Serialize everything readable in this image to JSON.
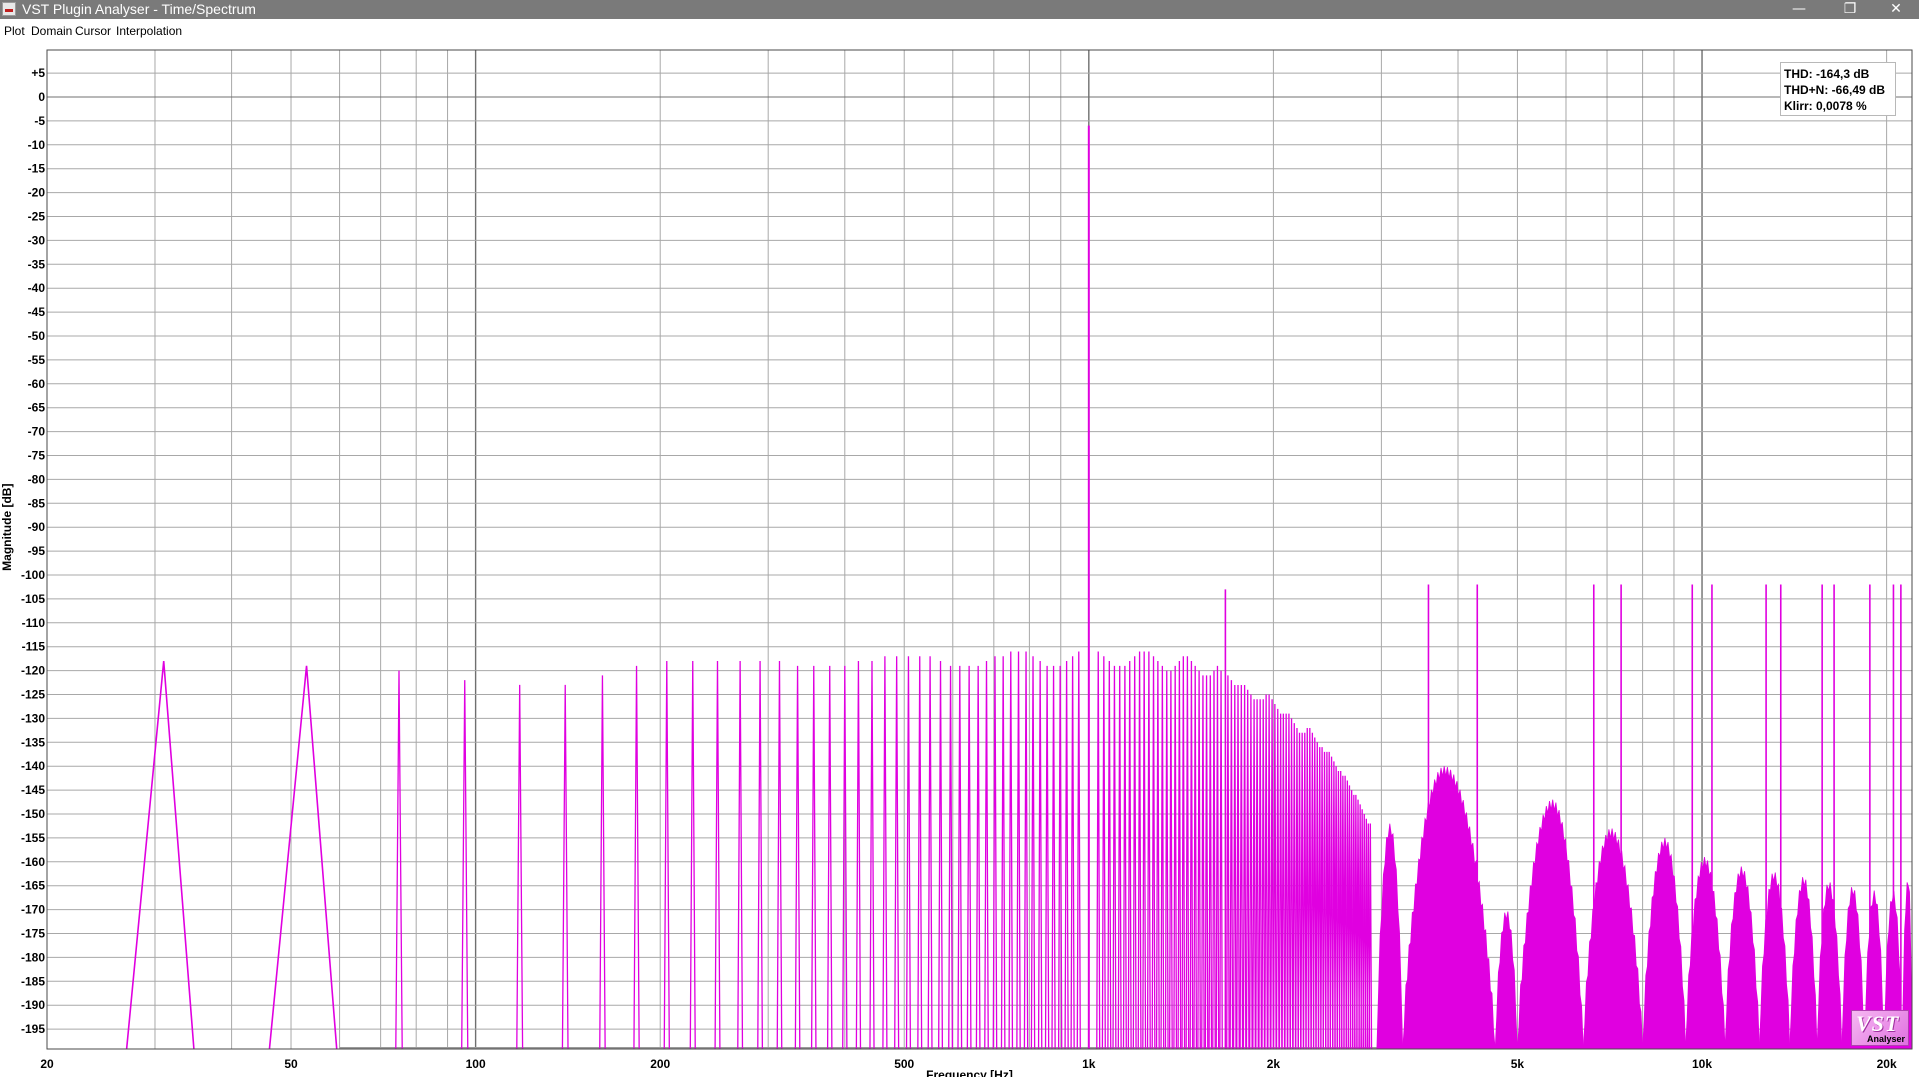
{
  "window": {
    "title": "VST Plugin Analyser - Time/Spectrum",
    "icon": "app-icon",
    "controls": [
      "minimize-icon",
      "restore-icon",
      "close-icon"
    ]
  },
  "menu": {
    "items": [
      "Plot",
      "Domain",
      "Cursor",
      "Interpolation"
    ]
  },
  "stats": {
    "thd": "THD: -164,3 dB",
    "thdn": "THD+N: -66,49 dB",
    "klirr": "Klirr: 0,0078 %"
  },
  "logo": {
    "sub": "Analyser"
  },
  "colors": {
    "spectrum": "#e000e0",
    "grid": "#a8a8a8",
    "titlebar": "#7a7a7a"
  },
  "chart_data": {
    "type": "line",
    "xscale": "log",
    "xlim": [
      20,
      22000
    ],
    "ylim": [
      -200,
      10
    ],
    "grid": true,
    "xlabel": "Frequency [Hz]",
    "ylabel": "Magnitude [dB]",
    "x_ticks": [
      {
        "v": 20,
        "label": "20"
      },
      {
        "v": 50,
        "label": "50"
      },
      {
        "v": 100,
        "label": "100"
      },
      {
        "v": 200,
        "label": "200"
      },
      {
        "v": 500,
        "label": "500"
      },
      {
        "v": 1000,
        "label": "1k"
      },
      {
        "v": 2000,
        "label": "2k"
      },
      {
        "v": 5000,
        "label": "5k"
      },
      {
        "v": 10000,
        "label": "10k"
      },
      {
        "v": 20000,
        "label": "20k"
      }
    ],
    "y_ticks": [
      "+5",
      "0",
      "-5",
      "-10",
      "-15",
      "-20",
      "-25",
      "-30",
      "-35",
      "-40",
      "-45",
      "-50",
      "-55",
      "-60",
      "-65",
      "-70",
      "-75",
      "-80",
      "-85",
      "-90",
      "-95",
      "-100",
      "-105",
      "-110",
      "-115",
      "-120",
      "-125",
      "-130",
      "-135",
      "-140",
      "-145",
      "-150",
      "-155",
      "-160",
      "-165",
      "-170",
      "-175",
      "-180",
      "-185",
      "-190",
      "-195"
    ],
    "fundamental": {
      "freq": 1000,
      "level": -6
    },
    "spur_lines": [
      {
        "freq": 1670,
        "level": -103
      },
      {
        "freq": 3580,
        "level": -102
      },
      {
        "freq": 4300,
        "level": -102
      },
      {
        "freq": 6660,
        "level": -102
      },
      {
        "freq": 7380,
        "level": -102
      },
      {
        "freq": 9640,
        "level": -102
      },
      {
        "freq": 10380,
        "level": -102
      },
      {
        "freq": 12720,
        "level": -102
      },
      {
        "freq": 13440,
        "level": -102
      },
      {
        "freq": 15700,
        "level": -102
      },
      {
        "freq": 16420,
        "level": -102
      },
      {
        "freq": 18780,
        "level": -102
      },
      {
        "freq": 20520,
        "level": -102
      },
      {
        "freq": 21100,
        "level": -102
      }
    ],
    "comb_spikes": [
      {
        "freq": 31,
        "level": -118
      },
      {
        "freq": 53,
        "level": -119
      },
      {
        "freq": 75,
        "level": -120
      },
      {
        "freq": 96,
        "level": -122
      },
      {
        "freq": 118,
        "level": -123
      },
      {
        "freq": 140,
        "level": -123
      },
      {
        "freq": 161,
        "level": -121
      },
      {
        "freq": 183,
        "level": -119
      },
      {
        "freq": 205,
        "level": -118
      },
      {
        "freq": 226,
        "level": -118
      },
      {
        "freq": 248,
        "level": -118
      },
      {
        "freq": 270,
        "level": -118
      },
      {
        "freq": 291,
        "level": -118
      },
      {
        "freq": 313,
        "level": -118
      },
      {
        "freq": 335,
        "level": -119
      },
      {
        "freq": 356,
        "level": -119
      },
      {
        "freq": 378,
        "level": -119
      },
      {
        "freq": 400,
        "level": -119
      },
      {
        "freq": 421,
        "level": -118
      },
      {
        "freq": 443,
        "level": -118
      },
      {
        "freq": 465,
        "level": -117
      },
      {
        "freq": 486,
        "level": -117
      },
      {
        "freq": 508,
        "level": -117
      },
      {
        "freq": 530,
        "level": -117
      },
      {
        "freq": 551,
        "level": -117
      },
      {
        "freq": 573,
        "level": -118
      },
      {
        "freq": 595,
        "level": -119
      },
      {
        "freq": 616,
        "level": -119
      },
      {
        "freq": 638,
        "level": -119
      },
      {
        "freq": 660,
        "level": -119
      },
      {
        "freq": 681,
        "level": -118
      },
      {
        "freq": 703,
        "level": -117
      },
      {
        "freq": 725,
        "level": -117
      },
      {
        "freq": 746,
        "level": -116
      },
      {
        "freq": 768,
        "level": -116
      },
      {
        "freq": 790,
        "level": -116
      },
      {
        "freq": 811,
        "level": -117
      },
      {
        "freq": 833,
        "level": -118
      },
      {
        "freq": 855,
        "level": -119
      },
      {
        "freq": 876,
        "level": -119
      },
      {
        "freq": 898,
        "level": -119
      },
      {
        "freq": 920,
        "level": -118
      },
      {
        "freq": 941,
        "level": -117
      },
      {
        "freq": 963,
        "level": -116
      },
      {
        "freq": 1036,
        "level": -116
      },
      {
        "freq": 1058,
        "level": -117
      },
      {
        "freq": 1080,
        "level": -118
      },
      {
        "freq": 1101,
        "level": -119
      },
      {
        "freq": 1123,
        "level": -119
      },
      {
        "freq": 1145,
        "level": -119
      },
      {
        "freq": 1166,
        "level": -118
      },
      {
        "freq": 1188,
        "level": -117
      },
      {
        "freq": 1210,
        "level": -116
      },
      {
        "freq": 1231,
        "level": -116
      },
      {
        "freq": 1253,
        "level": -116
      },
      {
        "freq": 1275,
        "level": -117
      },
      {
        "freq": 1296,
        "level": -118
      },
      {
        "freq": 1318,
        "level": -119
      },
      {
        "freq": 1340,
        "level": -120
      },
      {
        "freq": 1361,
        "level": -120
      },
      {
        "freq": 1383,
        "level": -119
      },
      {
        "freq": 1405,
        "level": -118
      },
      {
        "freq": 1426,
        "level": -117
      },
      {
        "freq": 1448,
        "level": -117
      },
      {
        "freq": 1470,
        "level": -118
      },
      {
        "freq": 1491,
        "level": -119
      },
      {
        "freq": 1513,
        "level": -120
      },
      {
        "freq": 1535,
        "level": -121
      },
      {
        "freq": 1556,
        "level": -121
      },
      {
        "freq": 1578,
        "level": -121
      },
      {
        "freq": 1600,
        "level": -120
      },
      {
        "freq": 1621,
        "level": -119
      },
      {
        "freq": 1643,
        "level": -120
      },
      {
        "freq": 1686,
        "level": -121
      },
      {
        "freq": 1708,
        "level": -122
      },
      {
        "freq": 1730,
        "level": -123
      },
      {
        "freq": 1751,
        "level": -123
      },
      {
        "freq": 1773,
        "level": -123
      },
      {
        "freq": 1795,
        "level": -123
      },
      {
        "freq": 1816,
        "level": -124
      },
      {
        "freq": 1838,
        "level": -125
      },
      {
        "freq": 1860,
        "level": -126
      },
      {
        "freq": 1881,
        "level": -126
      },
      {
        "freq": 1903,
        "level": -126
      },
      {
        "freq": 1925,
        "level": -126
      },
      {
        "freq": 1946,
        "level": -125
      },
      {
        "freq": 1968,
        "level": -125
      },
      {
        "freq": 1990,
        "level": -126
      },
      {
        "freq": 2011,
        "level": -127
      },
      {
        "freq": 2033,
        "level": -128
      },
      {
        "freq": 2055,
        "level": -129
      },
      {
        "freq": 2076,
        "level": -129
      },
      {
        "freq": 2098,
        "level": -129
      },
      {
        "freq": 2120,
        "level": -129
      },
      {
        "freq": 2141,
        "level": -130
      },
      {
        "freq": 2163,
        "level": -131
      },
      {
        "freq": 2185,
        "level": -132
      },
      {
        "freq": 2206,
        "level": -133
      },
      {
        "freq": 2228,
        "level": -133
      },
      {
        "freq": 2250,
        "level": -133
      },
      {
        "freq": 2271,
        "level": -132
      },
      {
        "freq": 2293,
        "level": -132
      },
      {
        "freq": 2315,
        "level": -133
      },
      {
        "freq": 2336,
        "level": -134
      },
      {
        "freq": 2358,
        "level": -135
      },
      {
        "freq": 2380,
        "level": -136
      },
      {
        "freq": 2401,
        "level": -136
      },
      {
        "freq": 2423,
        "level": -137
      },
      {
        "freq": 2445,
        "level": -137
      },
      {
        "freq": 2466,
        "level": -137
      },
      {
        "freq": 2488,
        "level": -138
      },
      {
        "freq": 2510,
        "level": -139
      },
      {
        "freq": 2531,
        "level": -140
      },
      {
        "freq": 2553,
        "level": -141
      },
      {
        "freq": 2575,
        "level": -141
      },
      {
        "freq": 2596,
        "level": -142
      },
      {
        "freq": 2618,
        "level": -142
      },
      {
        "freq": 2640,
        "level": -143
      },
      {
        "freq": 2661,
        "level": -144
      },
      {
        "freq": 2683,
        "level": -145
      },
      {
        "freq": 2705,
        "level": -146
      },
      {
        "freq": 2726,
        "level": -146
      },
      {
        "freq": 2748,
        "level": -147
      },
      {
        "freq": 2770,
        "level": -148
      },
      {
        "freq": 2791,
        "level": -149
      },
      {
        "freq": 2813,
        "level": -150
      },
      {
        "freq": 2835,
        "level": -151
      },
      {
        "freq": 2856,
        "level": -152
      },
      {
        "freq": 2878,
        "level": -152
      }
    ],
    "lobes": [
      {
        "from": 2950,
        "to": 3250,
        "peak_at": 3100,
        "top": -152
      },
      {
        "from": 3250,
        "to": 4600,
        "peak_at": 3800,
        "top": -140
      },
      {
        "from": 4600,
        "to": 5000,
        "peak_at": 4800,
        "top": -170
      },
      {
        "from": 5000,
        "to": 6400,
        "peak_at": 5700,
        "top": -147
      },
      {
        "from": 6400,
        "to": 8000,
        "peak_at": 7100,
        "top": -153
      },
      {
        "from": 8000,
        "to": 9400,
        "peak_at": 8700,
        "top": -155
      },
      {
        "from": 9400,
        "to": 10900,
        "peak_at": 10100,
        "top": -159
      },
      {
        "from": 10900,
        "to": 12400,
        "peak_at": 11600,
        "top": -161
      },
      {
        "from": 12400,
        "to": 13900,
        "peak_at": 13100,
        "top": -162
      },
      {
        "from": 13900,
        "to": 15400,
        "peak_at": 14650,
        "top": -163
      },
      {
        "from": 15400,
        "to": 16900,
        "peak_at": 16100,
        "top": -164
      },
      {
        "from": 16900,
        "to": 18400,
        "peak_at": 17600,
        "top": -165
      },
      {
        "from": 18400,
        "to": 19800,
        "peak_at": 19100,
        "top": -166
      },
      {
        "from": 19800,
        "to": 21200,
        "peak_at": 20500,
        "top": -166
      },
      {
        "from": 21200,
        "to": 22000,
        "peak_at": 21700,
        "top": -163
      }
    ],
    "gaps": [
      31,
      53
    ],
    "floor_from": 60
  }
}
